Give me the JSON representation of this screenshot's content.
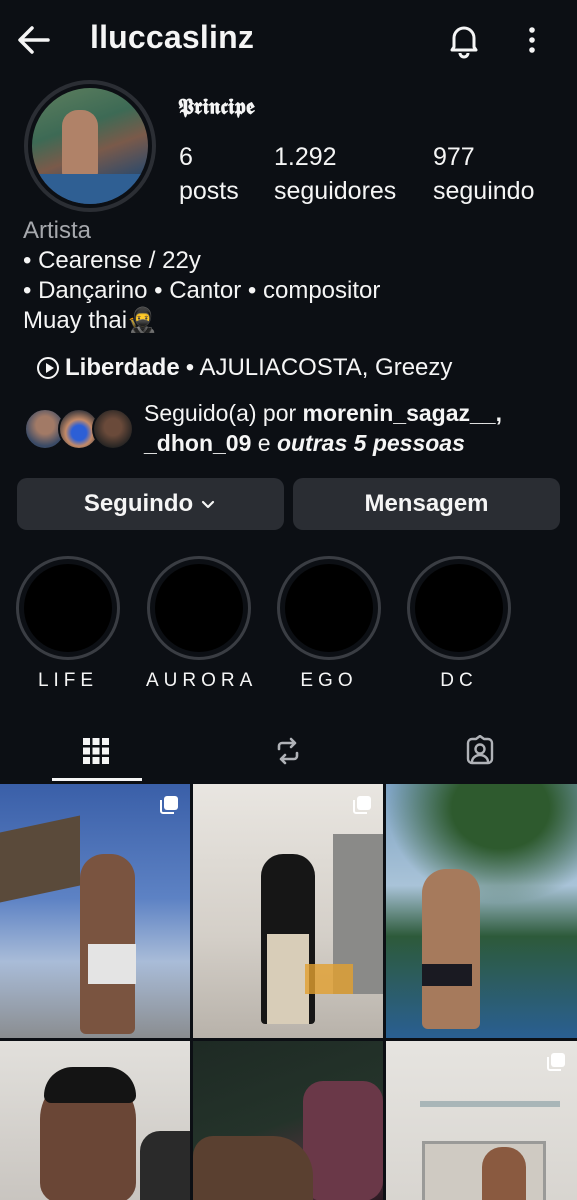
{
  "header": {
    "username": "lluccaslinz",
    "back_icon": "arrow-left-icon",
    "bell_icon": "bell-icon",
    "more_icon": "more-vertical-icon"
  },
  "profile": {
    "display_name": "𝕻𝖗𝖎𝖓𝖈𝖎𝖕𝖊",
    "stats": {
      "posts": {
        "value": "6",
        "label": "posts"
      },
      "followers": {
        "value": "1.292",
        "label": "seguidores"
      },
      "following": {
        "value": "977",
        "label": "seguindo"
      }
    },
    "bio": {
      "category": "Artista",
      "lines": [
        "• Cearense / 22y",
        "• Dançarino • Cantor • compositor",
        "Muay thai🥷"
      ]
    },
    "music": {
      "song": "Liberdade",
      "artists": "• AJULIACOSTA, Greezy"
    },
    "followed_by": {
      "prefix": "Seguido(a) por ",
      "user1": "morenin_sagaz__,",
      "user2": "_dhon_09",
      "conj": " e ",
      "others": "outras 5 pessoas"
    }
  },
  "actions": {
    "following_label": "Seguindo",
    "message_label": "Mensagem"
  },
  "highlights": [
    {
      "label": "LIFE"
    },
    {
      "label": "AURORA"
    },
    {
      "label": "EGO"
    },
    {
      "label": "DC"
    }
  ],
  "tabs": {
    "grid_icon": "grid-icon",
    "reposts_icon": "repost-icon",
    "tagged_icon": "tagged-person-icon",
    "active": "grid"
  },
  "colors": {
    "background": "#0c0f14",
    "button": "#2a2d33",
    "text": "#f5f5f5",
    "muted": "#a6a8ad"
  }
}
